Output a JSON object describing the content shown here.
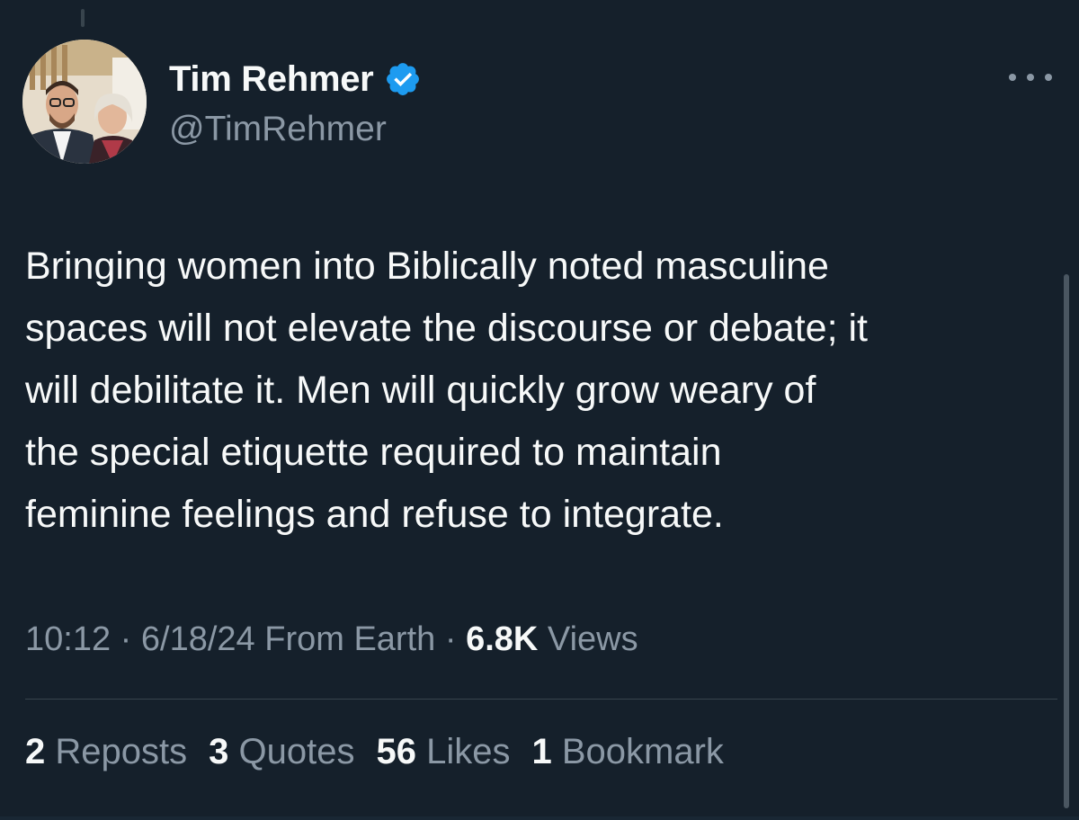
{
  "author": {
    "display_name": "Tim Rehmer",
    "handle": "@TimRehmer",
    "verified": true,
    "avatar_icon": "profile-photo"
  },
  "tweet": {
    "lines": [
      "Bringing women into Biblically noted masculine",
      "spaces will not elevate the discourse or debate; it",
      "will debilitate it. Men will quickly grow weary of",
      "the special etiquette required to maintain",
      "feminine feelings and refuse to integrate."
    ]
  },
  "meta": {
    "time": "10:12",
    "separator": "·",
    "date": "6/18/24",
    "source": "From Earth",
    "views_count": "6.8K",
    "views_label": "Views"
  },
  "stats": {
    "reposts_count": "2",
    "reposts_label": "Reposts",
    "quotes_count": "3",
    "quotes_label": "Quotes",
    "likes_count": "56",
    "likes_label": "Likes",
    "bookmarks_count": "1",
    "bookmarks_label": "Bookmark"
  },
  "colors": {
    "background": "#15202b",
    "primary_text": "#f7f9f9",
    "secondary_text": "#8b98a5",
    "verified_badge": "#1d9bf0",
    "divider": "#38444d"
  },
  "icons": {
    "verified": "verified-badge-icon",
    "more": "more-options-icon"
  }
}
